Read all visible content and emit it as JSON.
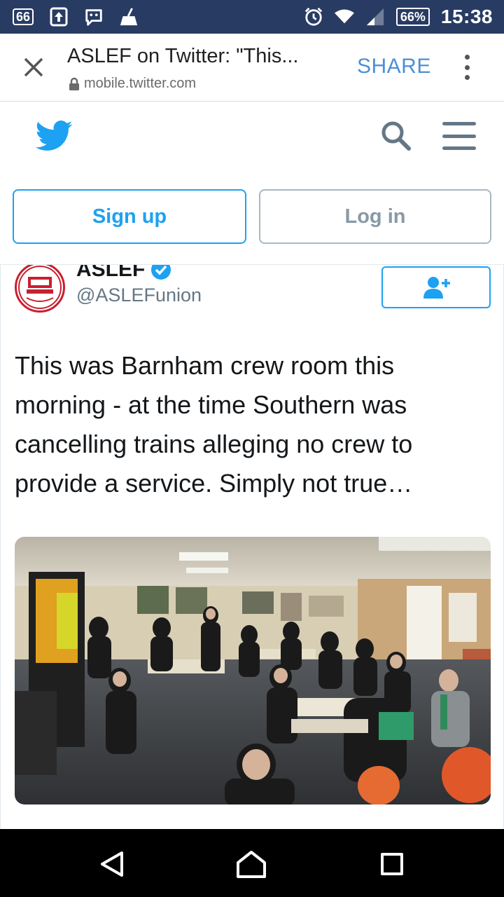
{
  "status_bar": {
    "notification_count": "66",
    "battery": "66%",
    "time": "15:38",
    "icons": [
      "upload-icon",
      "blackberry-messenger-icon",
      "cleaner-icon",
      "alarm-icon",
      "wifi-icon",
      "signal-icon",
      "battery-icon"
    ]
  },
  "toolbar": {
    "title": "ASLEF on Twitter: \"This...",
    "url": "mobile.twitter.com",
    "share_label": "SHARE"
  },
  "twitter_header": {
    "signup_label": "Sign up",
    "login_label": "Log in"
  },
  "tweet": {
    "name": "ASLEF",
    "verified": true,
    "handle": "@ASLEFunion",
    "text": "This was Barnham crew room this morning - at the time Southern was cancelling trains alleging no crew to provide a service. Simply not true…"
  },
  "colors": {
    "status_bar_bg": "#283b63",
    "twitter_blue": "#1da1f2",
    "share_blue": "#4d8fd6",
    "login_gray": "#8899a6",
    "nav_bg": "#000000"
  }
}
